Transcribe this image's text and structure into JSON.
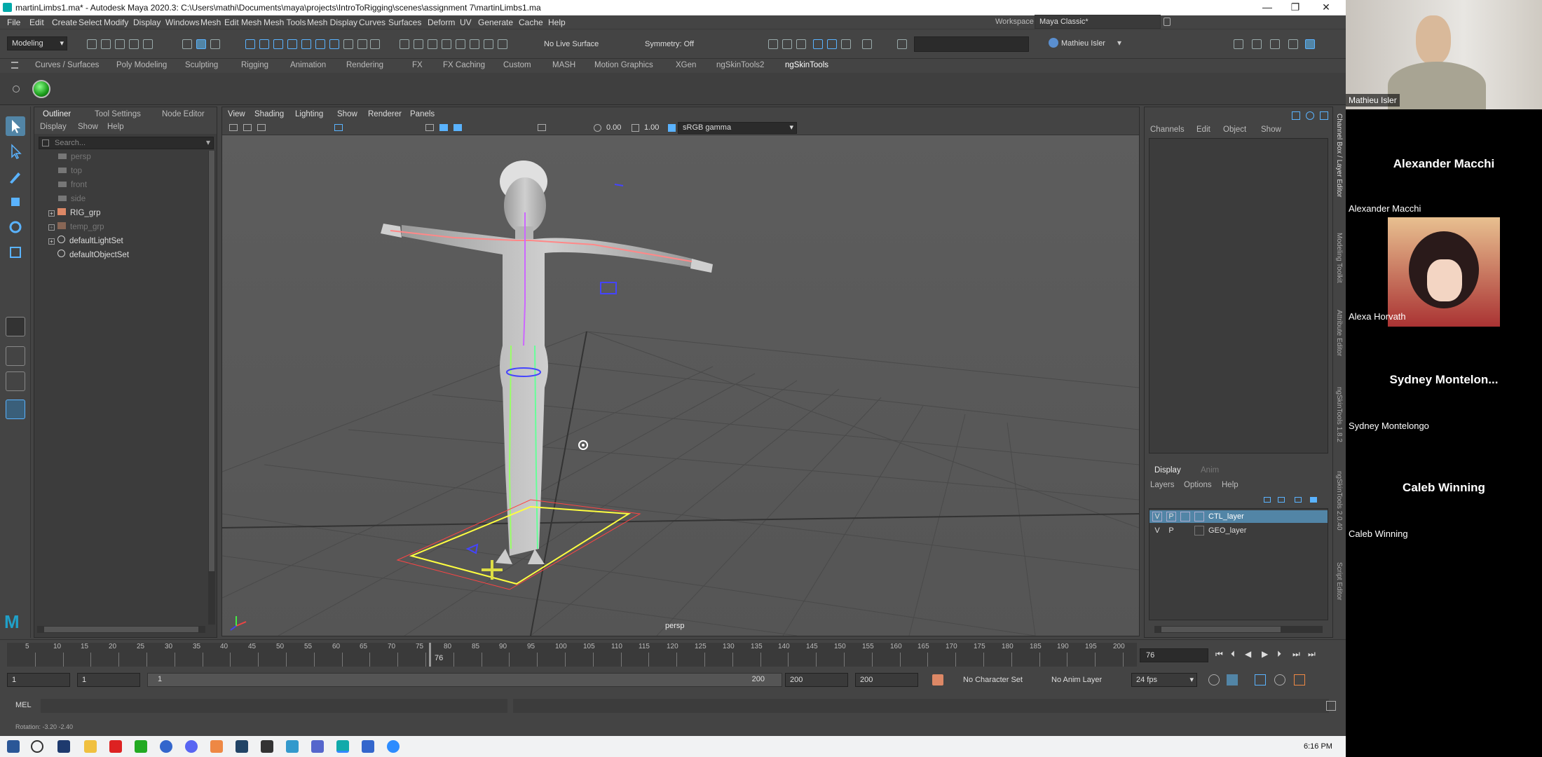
{
  "titlebar": {
    "title": "martinLimbs1.ma* - Autodesk Maya 2020.3: C:\\Users\\mathi\\Documents\\maya\\projects\\IntroToRigging\\scenes\\assignment 7\\martinLimbs1.ma",
    "minimize": "—",
    "restore": "❐",
    "close": "✕"
  },
  "menubar": {
    "items": [
      "File",
      "Edit",
      "Create",
      "Select",
      "Modify",
      "Display",
      "Windows",
      "Mesh",
      "Edit Mesh",
      "Mesh Tools",
      "Mesh Display",
      "Curves",
      "Surfaces",
      "Deform",
      "UV",
      "Generate",
      "Cache",
      "Help"
    ],
    "workspace_label": "Workspace :",
    "workspace_value": "Maya Classic*"
  },
  "toolbar": {
    "mode": "Modeling",
    "live_surface": "No Live Surface",
    "symmetry": "Symmetry: Off",
    "user": "Mathieu Isler"
  },
  "shelf": {
    "tabs": [
      "Curves / Surfaces",
      "Poly Modeling",
      "Sculpting",
      "Rigging",
      "Animation",
      "Rendering",
      "FX",
      "FX Caching",
      "Custom",
      "MASH",
      "Motion Graphics",
      "XGen",
      "ngSkinTools2",
      "ngSkinTools"
    ],
    "active": "ngSkinTools"
  },
  "outliner": {
    "tabs": [
      "Outliner",
      "Tool Settings",
      "Node Editor"
    ],
    "menu": [
      "Display",
      "Show",
      "Help"
    ],
    "search_placeholder": "Search...",
    "items": [
      {
        "label": "persp",
        "dim": true,
        "icon": "camera-icon"
      },
      {
        "label": "top",
        "dim": true,
        "icon": "camera-icon"
      },
      {
        "label": "front",
        "dim": true,
        "icon": "camera-icon"
      },
      {
        "label": "side",
        "dim": true,
        "icon": "camera-icon"
      },
      {
        "label": "RIG_grp",
        "dim": false,
        "icon": "group-icon",
        "expand": true
      },
      {
        "label": "temp_grp",
        "dim": true,
        "icon": "group-icon",
        "expand": true
      },
      {
        "label": "defaultLightSet",
        "dim": false,
        "icon": "set-icon",
        "expand": true
      },
      {
        "label": "defaultObjectSet",
        "dim": false,
        "icon": "set-icon",
        "expand": false
      }
    ]
  },
  "viewport": {
    "menu": [
      "View",
      "Shading",
      "Lighting",
      "Show",
      "Renderer",
      "Panels"
    ],
    "exposure": "0.00",
    "gamma": "1.00",
    "colorspace": "sRGB gamma",
    "camera_label": "persp"
  },
  "channelbox": {
    "menu": [
      "Channels",
      "Edit",
      "Object",
      "Show"
    ],
    "layer_tabs": [
      "Display",
      "Anim"
    ],
    "layer_menu": [
      "Layers",
      "Options",
      "Help"
    ],
    "layers": [
      {
        "v": "V",
        "p": "P",
        "name": "CTL_layer",
        "selected": true
      },
      {
        "v": "V",
        "p": "P",
        "name": "GEO_layer",
        "selected": false
      }
    ]
  },
  "sidetabs": [
    "Channel Box / Layer Editor",
    "Modeling Toolkit",
    "Attribute Editor",
    "ngSkinTools 1.8.2",
    "ngSkinTools 2.0.40",
    "Script Editor"
  ],
  "timeline": {
    "ticks": [
      "5",
      "10",
      "15",
      "20",
      "25",
      "30",
      "35",
      "40",
      "45",
      "50",
      "55",
      "60",
      "65",
      "70",
      "75",
      "80",
      "85",
      "90",
      "95",
      "100",
      "105",
      "110",
      "115",
      "120",
      "125",
      "130",
      "135",
      "140",
      "145",
      "150",
      "155",
      "160",
      "165",
      "170",
      "175",
      "180",
      "185",
      "190",
      "195",
      "200"
    ],
    "current_frame_marker": "76",
    "current_frame": "76"
  },
  "range": {
    "start": "1",
    "start2": "1",
    "slider_start": "1",
    "slider_end": "200",
    "end": "200",
    "end2": "200",
    "character_set": "No Character Set",
    "anim_layer": "No Anim Layer",
    "fps": "24 fps"
  },
  "cmdline": {
    "label": "MEL"
  },
  "helpline": {
    "text": "Rotation:   -3.20    -2.40"
  },
  "taskbar": {
    "time": "6:16 PM"
  },
  "video": {
    "self_name": "Mathieu Isler",
    "participants": [
      {
        "big": "Alexander Macchi",
        "small": "Alexander Macchi"
      },
      {
        "big": "",
        "small": "Alexa Horvath"
      },
      {
        "big": "Sydney  Montelon...",
        "small": "Sydney Montelongo"
      },
      {
        "big": "Caleb Winning",
        "small": "Caleb Winning"
      }
    ]
  },
  "colors": {
    "maya_bg": "#444444",
    "viewport_bg": "#585858",
    "selection": "#5285a6",
    "accent_blue": "#5ab3ff"
  }
}
